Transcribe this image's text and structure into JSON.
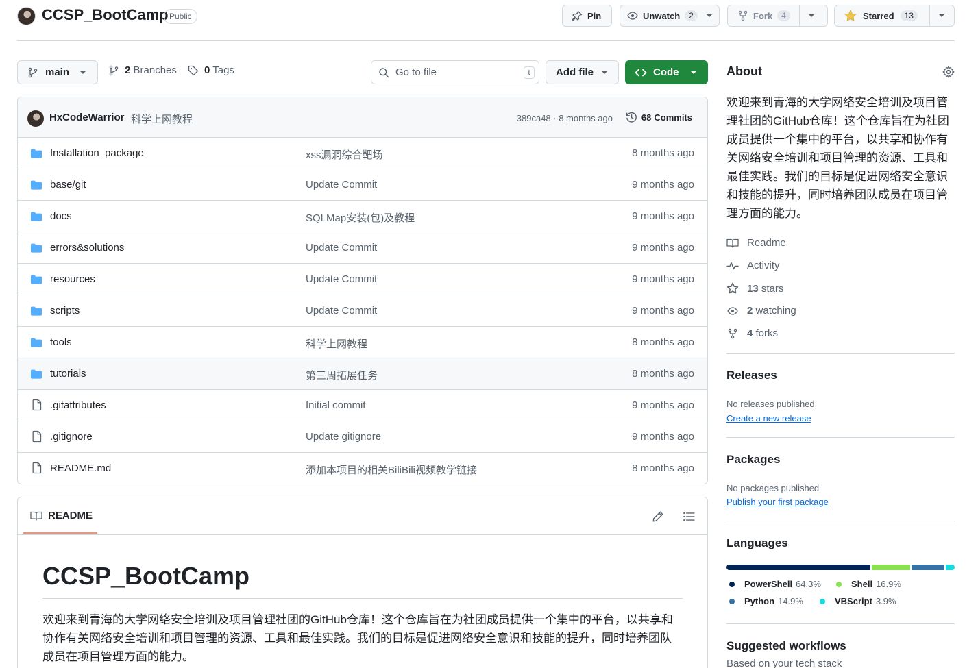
{
  "repo": {
    "name": "CCSP_BootCamp",
    "visibility": "Public",
    "pin_label": "Pin",
    "unwatch_label": "Unwatch",
    "watch_count": "2",
    "fork_label": "Fork",
    "fork_count": "4",
    "starred_label": "Starred",
    "star_count": "13"
  },
  "toolbar": {
    "branch": "main",
    "branches_count": "2",
    "branches_label": "Branches",
    "tags_count": "0",
    "tags_label": "Tags",
    "goto_placeholder": "Go to file",
    "goto_shortcut": "t",
    "add_file_label": "Add file",
    "code_label": "Code"
  },
  "latest_commit": {
    "author": "HxCodeWarrior",
    "message": "科学上网教程",
    "meta": "389ca48 · 8 months ago",
    "commits_count": "68",
    "commits_label": "Commits"
  },
  "files": [
    {
      "type": "dir",
      "name": "Installation_package",
      "message": "xss漏洞综合靶场",
      "date": "8 months ago"
    },
    {
      "type": "dir",
      "name": "base/git",
      "message": "Update Commit",
      "date": "9 months ago"
    },
    {
      "type": "dir",
      "name": "docs",
      "message": "SQLMap安装(包)及教程",
      "date": "9 months ago"
    },
    {
      "type": "dir",
      "name": "errors&solutions",
      "message": "Update Commit",
      "date": "9 months ago"
    },
    {
      "type": "dir",
      "name": "resources",
      "message": "Update Commit",
      "date": "9 months ago"
    },
    {
      "type": "dir",
      "name": "scripts",
      "message": "Update Commit",
      "date": "9 months ago"
    },
    {
      "type": "dir",
      "name": "tools",
      "message": "科学上网教程",
      "date": "8 months ago"
    },
    {
      "type": "dir",
      "name": "tutorials",
      "message": "第三周拓展任务",
      "date": "8 months ago"
    },
    {
      "type": "file",
      "name": ".gitattributes",
      "message": "Initial commit",
      "date": "9 months ago"
    },
    {
      "type": "file",
      "name": ".gitignore",
      "message": "Update gitignore",
      "date": "9 months ago"
    },
    {
      "type": "file",
      "name": "README.md",
      "message": "添加本项目的相关BiliBili视频教学链接",
      "date": "8 months ago"
    }
  ],
  "readme": {
    "tab_label": "README",
    "title": "CCSP_BootCamp",
    "body": "欢迎来到青海的大学网络安全培训及项目管理社团的GitHub仓库！这个仓库旨在为社团成员提供一个集中的平台，以共享和协作有关网络安全培训和项目管理的资源、工具和最佳实践。我们的目标是促进网络安全意识和技能的提升，同时培养团队成员在项目管理方面的能力。"
  },
  "about": {
    "title": "About",
    "description": "欢迎来到青海的大学网络安全培训及项目管理社团的GitHub仓库！这个仓库旨在为社团成员提供一个集中的平台，以共享和协作有关网络安全培训和项目管理的资源、工具和最佳实践。我们的目标是促进网络安全意识和技能的提升，同时培养团队成员在项目管理方面的能力。",
    "readme_label": "Readme",
    "activity_label": "Activity",
    "stars_count": "13",
    "stars_label": "stars",
    "watching_count": "2",
    "watching_label": "watching",
    "forks_count": "4",
    "forks_label": "forks"
  },
  "releases": {
    "title": "Releases",
    "empty": "No releases published",
    "link": "Create a new release"
  },
  "packages": {
    "title": "Packages",
    "empty": "No packages published",
    "link": "Publish your first package"
  },
  "languages": {
    "title": "Languages",
    "items": [
      {
        "name": "PowerShell",
        "percent": "64.3%",
        "value": 64.3,
        "color": "#012456"
      },
      {
        "name": "Shell",
        "percent": "16.9%",
        "value": 16.9,
        "color": "#89e051"
      },
      {
        "name": "Python",
        "percent": "14.9%",
        "value": 14.9,
        "color": "#3572a5"
      },
      {
        "name": "VBScript",
        "percent": "3.9%",
        "value": 3.9,
        "color": "#15dcdc"
      }
    ]
  },
  "workflows": {
    "title": "Suggested workflows",
    "subtitle": "Based on your tech stack"
  }
}
